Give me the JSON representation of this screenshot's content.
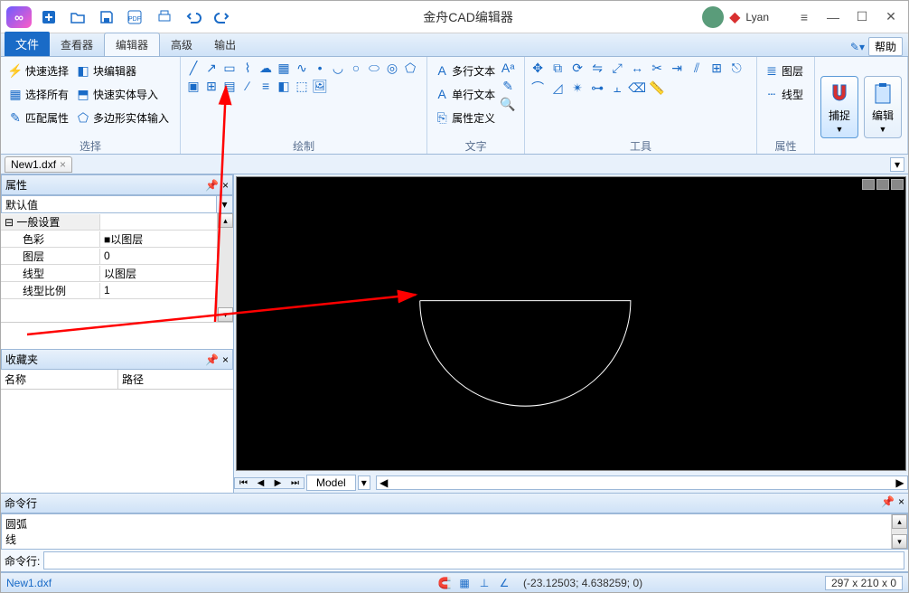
{
  "app_title": "金舟CAD编辑器",
  "user": {
    "name": "Lyan"
  },
  "qat": [
    "new",
    "open",
    "save",
    "pdf",
    "print",
    "undo",
    "redo"
  ],
  "tabs": {
    "file": "文件",
    "items": [
      "查看器",
      "编辑器",
      "高级",
      "输出"
    ],
    "active": 1,
    "help": "帮助"
  },
  "ribbon": {
    "select": {
      "label": "选择",
      "col1": [
        {
          "icon": "bolt",
          "label": "快速选择"
        },
        {
          "icon": "select-all",
          "label": "选择所有"
        },
        {
          "icon": "match",
          "label": "匹配属性"
        }
      ],
      "col2": [
        {
          "icon": "block",
          "label": "块编辑器"
        },
        {
          "icon": "import",
          "label": "快速实体导入"
        },
        {
          "icon": "poly",
          "label": "多边形实体输入"
        }
      ]
    },
    "draw": {
      "label": "绘制"
    },
    "text": {
      "label": "文字",
      "col": [
        {
          "icon": "mtext",
          "label": "多行文本"
        },
        {
          "icon": "stext",
          "label": "单行文本"
        },
        {
          "icon": "attrdef",
          "label": "属性定义"
        }
      ]
    },
    "tools": {
      "label": "工具"
    },
    "props": {
      "label": "属性",
      "col": [
        {
          "icon": "layer",
          "label": "图层"
        },
        {
          "icon": "linetype",
          "label": "线型"
        }
      ]
    },
    "snap": "捕捉",
    "edit": "编辑"
  },
  "doc_tab": "New1.dxf",
  "panels": {
    "properties": {
      "title": "属性",
      "combo": "默认值",
      "section": "一般设置",
      "rows": [
        {
          "k": "色彩",
          "v": "■以图层"
        },
        {
          "k": "图层",
          "v": "0"
        },
        {
          "k": "线型",
          "v": "以图层"
        },
        {
          "k": "线型比例",
          "v": "1"
        }
      ]
    },
    "favorites": {
      "title": "收藏夹",
      "cols": [
        "名称",
        "路径"
      ]
    }
  },
  "model_tab": "Model",
  "command": {
    "title": "命令行",
    "log": [
      "圆弧",
      "线"
    ],
    "prompt": "命令行:"
  },
  "status": {
    "file": "New1.dxf",
    "coords": "(-23.12503; 4.638259; 0)",
    "dims": "297 x 210 x 0"
  }
}
